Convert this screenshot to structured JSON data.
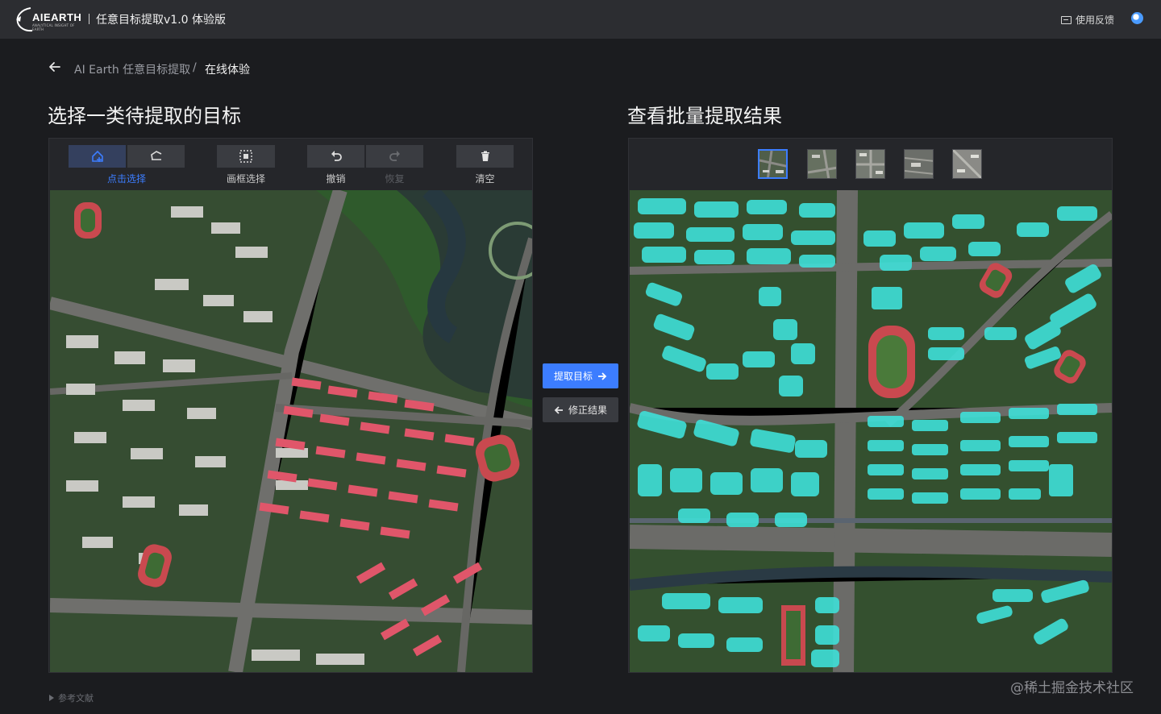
{
  "topbar": {
    "logo_text": "AIEARTH",
    "logo_sub": "ANALYTICAL INSIGHT OF EARTH",
    "title": "任意目标提取v1.0 体验版",
    "feedback_label": "使用反馈"
  },
  "breadcrumb": {
    "parent": "AI Earth 任意目标提取",
    "separator": "/",
    "current": "在线体验"
  },
  "left": {
    "heading": "选择一类待提取的目标",
    "tools": {
      "click_select": "点击选择",
      "box_select": "画框选择",
      "undo": "撤销",
      "redo": "恢复",
      "clear": "清空"
    }
  },
  "right": {
    "heading": "查看批量提取结果",
    "thumbnails_count_label": "",
    "selected_thumbnail": 1
  },
  "actions": {
    "extract": "提取目标",
    "revise": "修正结果"
  },
  "footer": {
    "references": "参考文献",
    "watermark": "@稀土掘金技术社区"
  },
  "colors": {
    "accent": "#3c7dff",
    "background": "#1b1c1f",
    "topbar": "#2c2d31",
    "segmentation_overlay": "#3fe0d8",
    "selected_target": "#e0566a"
  }
}
